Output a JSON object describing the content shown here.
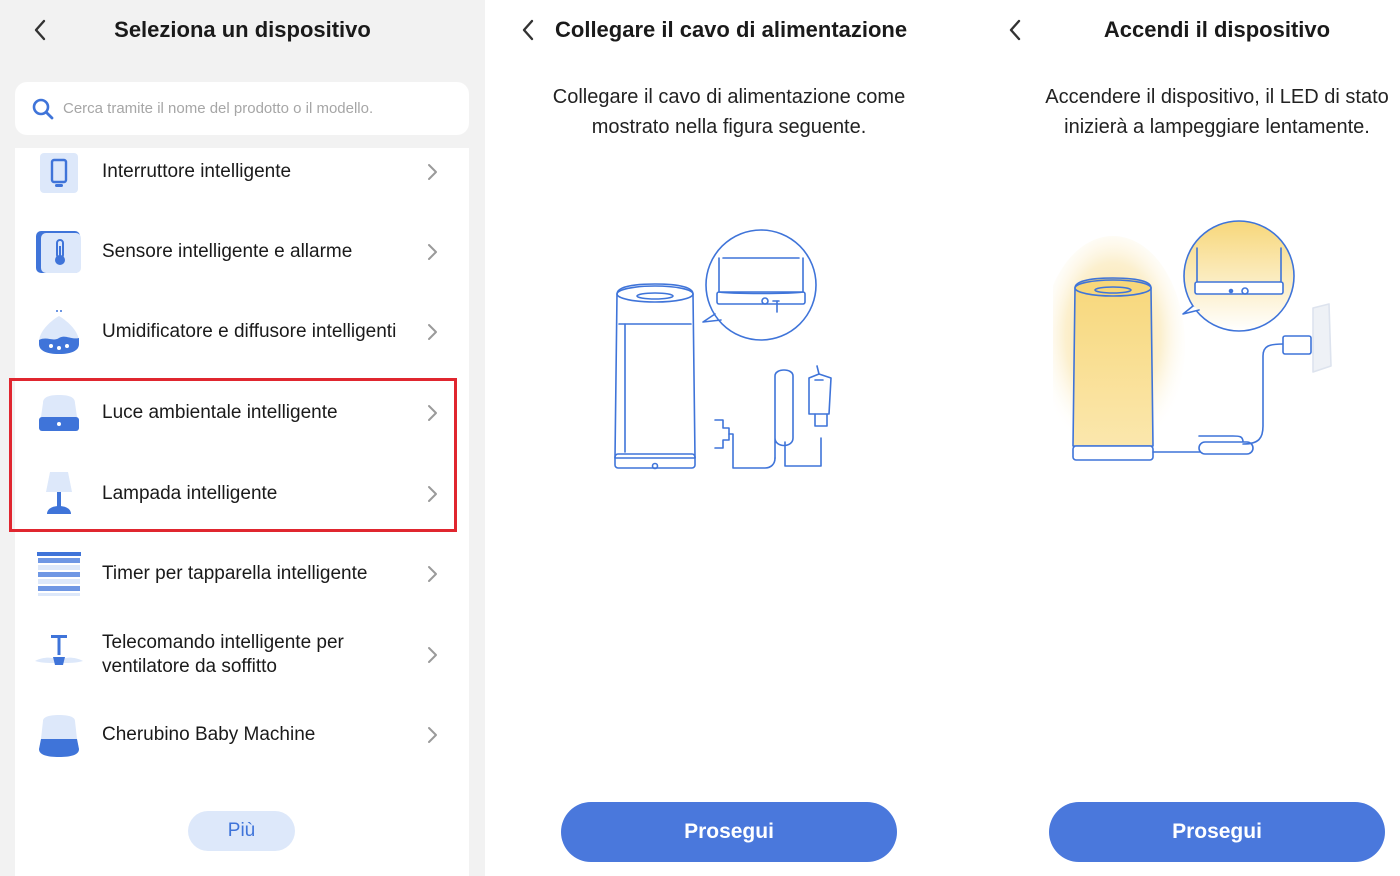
{
  "panel_select": {
    "title": "Seleziona un dispositivo",
    "search_placeholder": "Cerca tramite il nome del prodotto o il modello.",
    "items": [
      {
        "label": "Interruttore intelligente",
        "icon": "smart-switch-icon"
      },
      {
        "label": "Sensore intelligente e allarme",
        "icon": "thermometer-sensor-icon"
      },
      {
        "label": "Umidificatore e diffusore intelligenti",
        "icon": "humidifier-icon"
      },
      {
        "label": "Luce ambientale intelligente",
        "icon": "ambient-light-icon"
      },
      {
        "label": "Lampada intelligente",
        "icon": "table-lamp-icon"
      },
      {
        "label": "Timer per tapparella intelligente",
        "icon": "blinds-icon"
      },
      {
        "label": "Telecomando intelligente per ventilatore da soffitto",
        "icon": "ceiling-fan-icon"
      },
      {
        "label": "Cherubino Baby Machine",
        "icon": "baby-machine-icon"
      }
    ],
    "more_label": "Più",
    "highlight_color": "#e0262f"
  },
  "panel_power": {
    "title": "Collegare il cavo di alimentazione",
    "description": "Collegare il cavo di alimentazione come mostrato nella figura seguente.",
    "button_label": "Prosegui"
  },
  "panel_on": {
    "title": "Accendi il dispositivo",
    "description": "Accendere il dispositivo, il LED di stato inizierà a lampeggiare lentamente.",
    "button_label": "Prosegui"
  },
  "colors": {
    "accent": "#4a78dc",
    "icon_blue": "#3f74d9",
    "illustration_line": "#3f74d9",
    "glow": "#f7d77a"
  }
}
